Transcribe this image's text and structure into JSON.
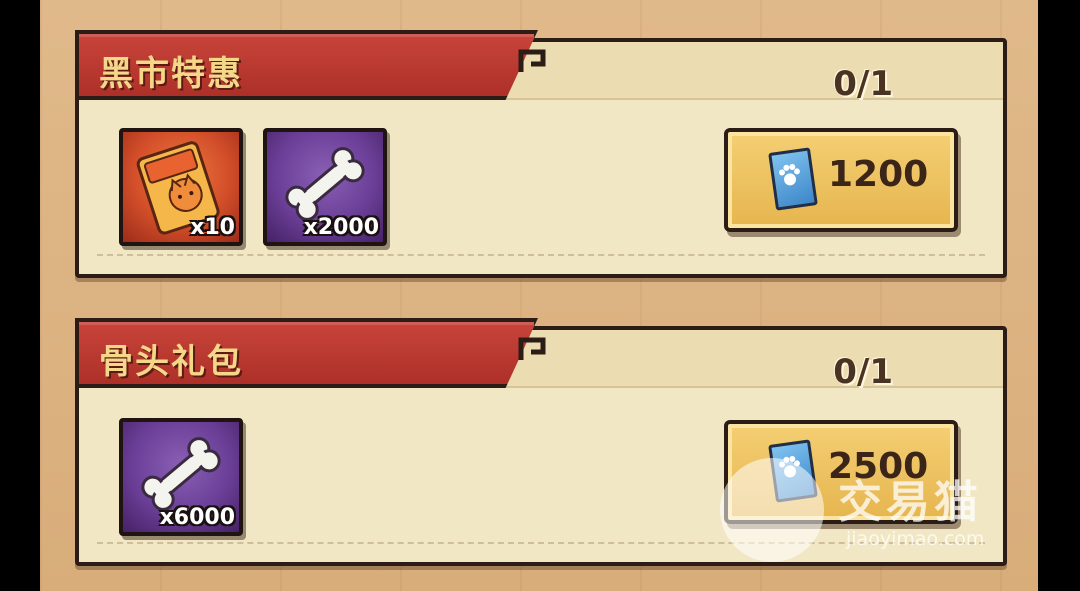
{
  "packs": [
    {
      "title": "黑市特惠",
      "progress": "0/1",
      "items": [
        {
          "icon": "skin-pack-icon",
          "qty": "x10"
        },
        {
          "icon": "bone-icon",
          "qty": "x2000"
        }
      ],
      "price": "1200",
      "currency_icon": "paw-ticket-icon"
    },
    {
      "title": "骨头礼包",
      "progress": "0/1",
      "items": [
        {
          "icon": "bone-icon",
          "qty": "x6000"
        }
      ],
      "price": "2500",
      "currency_icon": "paw-ticket-icon"
    }
  ],
  "watermark": {
    "text": "交易猫",
    "url": "jiaoyimao.com"
  },
  "colors": {
    "banner_red": "#c8443a",
    "banner_text": "#f5d78a",
    "panel_bg": "#f2e7c4",
    "price_button": "#f4cf73",
    "item_orange": "#d24e29",
    "item_purple": "#6b3f97"
  }
}
